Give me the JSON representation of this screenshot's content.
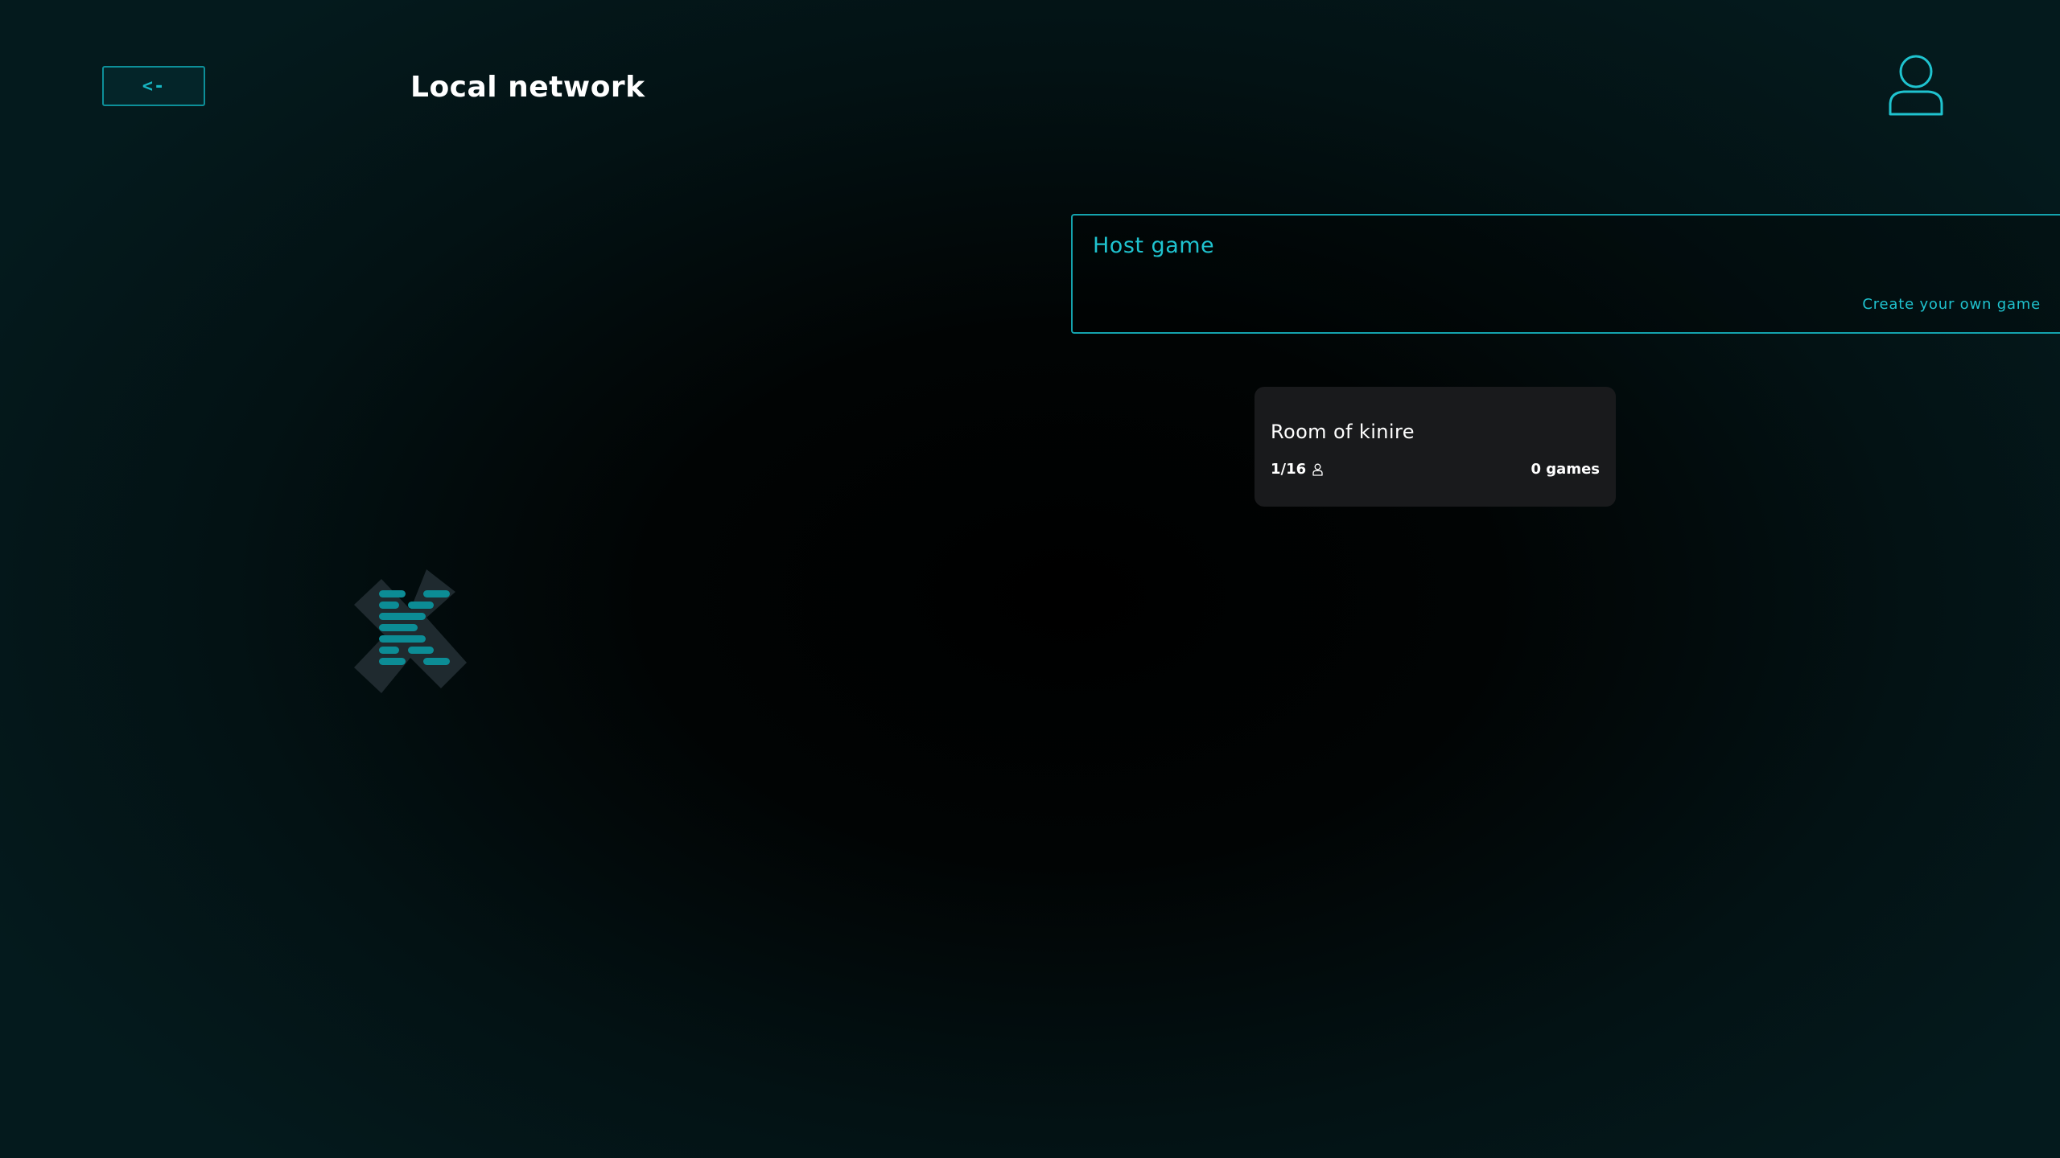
{
  "header": {
    "back_label": "<-",
    "title": "Local network",
    "profile_icon": "user-icon"
  },
  "host_panel": {
    "title": "Host game",
    "link": "Create your own game"
  },
  "rooms": [
    {
      "name": "Room of kinire",
      "players": "1/16",
      "players_icon": "person-icon",
      "games": "0 games"
    }
  ],
  "logo": {
    "icon": "app-logo-icon"
  },
  "colors": {
    "accent": "#1fc3cf",
    "accent_dark": "#0d8f99",
    "card_background": "#191a1c",
    "logo_background": "#1f2a2f",
    "text": "#ffffff"
  }
}
